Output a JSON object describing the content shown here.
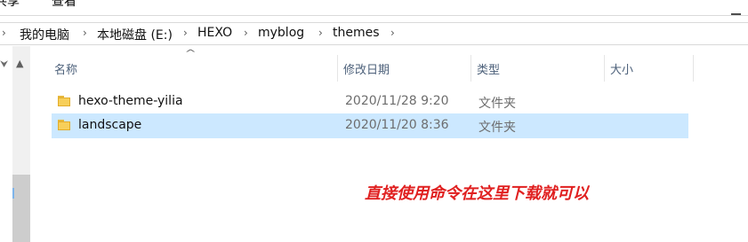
{
  "ribbon": {
    "tabs": [
      "共享",
      "查看"
    ]
  },
  "address": {
    "crumbs": [
      "我的电脑",
      "本地磁盘 (E:)",
      "HEXO",
      "myblog",
      "themes"
    ]
  },
  "columns": {
    "name": "名称",
    "date": "修改日期",
    "type": "类型",
    "size": "大小"
  },
  "files": [
    {
      "name": "hexo-theme-yilia",
      "date": "2020/11/28 9:20",
      "type": "文件夹",
      "selected": false
    },
    {
      "name": "landscape",
      "date": "2020/11/20 8:36",
      "type": "文件夹",
      "selected": true
    }
  ],
  "annotation": "直接使用命令在这里下载就可以",
  "colors": {
    "selection": "#cce8ff",
    "annotation": "#e02020",
    "folder": "#f7cf5a"
  },
  "icons": [
    "folder-icon",
    "pin-icon",
    "chevron-right-icon",
    "sort-up-icon",
    "scroll-up-icon"
  ]
}
